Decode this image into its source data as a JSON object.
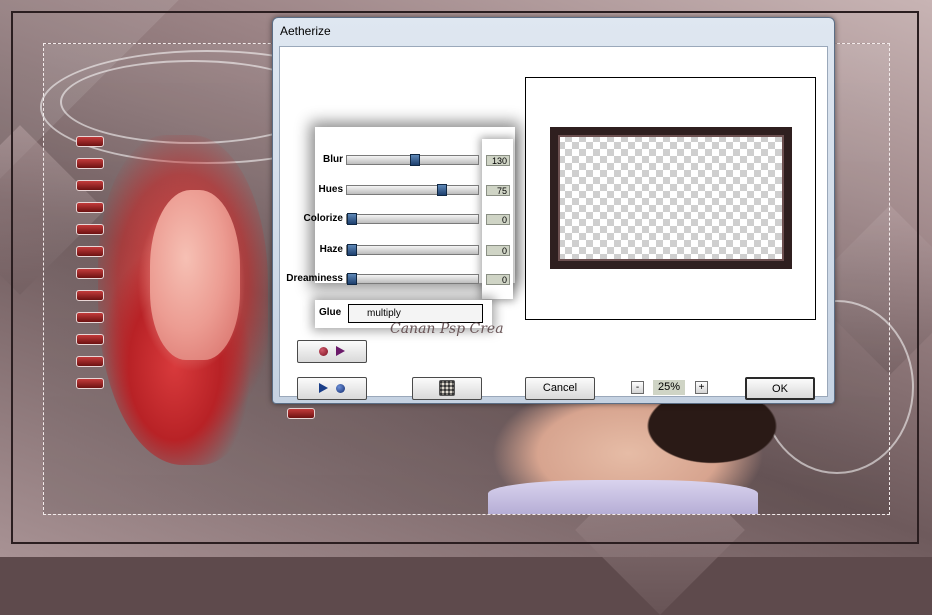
{
  "window": {
    "title": "Aetherize"
  },
  "sliders": [
    {
      "label": "Blur",
      "value": "130",
      "fraction": 0.52
    },
    {
      "label": "Hues",
      "value": "75",
      "fraction": 0.74
    },
    {
      "label": "Colorize",
      "value": "0",
      "fraction": 0.0
    },
    {
      "label": "Haze",
      "value": "0",
      "fraction": 0.0
    },
    {
      "label": "Dreaminess",
      "value": "0",
      "fraction": 0.0
    }
  ],
  "glue": {
    "label": "Glue",
    "value": "multiply"
  },
  "buttons": {
    "cancel": "Cancel",
    "ok": "OK"
  },
  "zoom": {
    "minus": "-",
    "value": "25%",
    "plus": "+"
  },
  "watermark": "Canan Psp Crea",
  "icons": {
    "load_preset": "load-preset-icon",
    "save_preset": "save-preset-icon",
    "randomize": "dice-icon"
  },
  "colors": {
    "thumb": "#1d3f6e",
    "value_field": "#cfd4c5"
  }
}
